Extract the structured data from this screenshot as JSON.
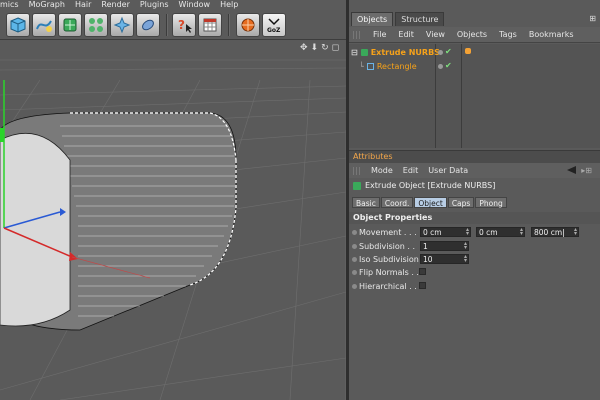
{
  "menu": [
    "mics",
    "MoGraph",
    "Hair",
    "Render",
    "Plugins",
    "Window",
    "Help"
  ],
  "toolbar": {
    "icons": [
      "cube-icon",
      "spline-pen-icon",
      "nurbs-icon",
      "array-icon",
      "deformer-icon",
      "environment-icon",
      "help-cursor-icon",
      "render-settings-icon",
      "render-icon",
      "goz-icon"
    ],
    "goz_label": "GoZ"
  },
  "tabs": [
    "Objects",
    "Structure"
  ],
  "object_menu": [
    "File",
    "Edit",
    "View",
    "Objects",
    "Tags",
    "Bookmarks"
  ],
  "objects": [
    {
      "name": "Extrude NURBS"
    },
    {
      "name": "Rectangle"
    }
  ],
  "attributes": {
    "header": "Attributes",
    "menu": [
      "Mode",
      "Edit",
      "User Data"
    ],
    "object_title": "Extrude Object [Extrude NURBS]",
    "tabs": [
      "Basic",
      "Coord.",
      "Object",
      "Caps",
      "Phong"
    ],
    "active_tab": "Object",
    "section": "Object Properties",
    "properties": {
      "movement_label": "Movement . . . .",
      "movement_x": "0 cm",
      "movement_y": "0 cm",
      "movement_z": "800 cm",
      "subdivision_label": "Subdivision . .",
      "subdivision": "1",
      "iso_label": "Iso Subdivision",
      "iso": "10",
      "flip_label": "Flip Normals . .",
      "hier_label": "Hierarchical . . ."
    }
  },
  "colors": {
    "accent": "#f6a21a",
    "active_tab": "#b8cde4"
  }
}
